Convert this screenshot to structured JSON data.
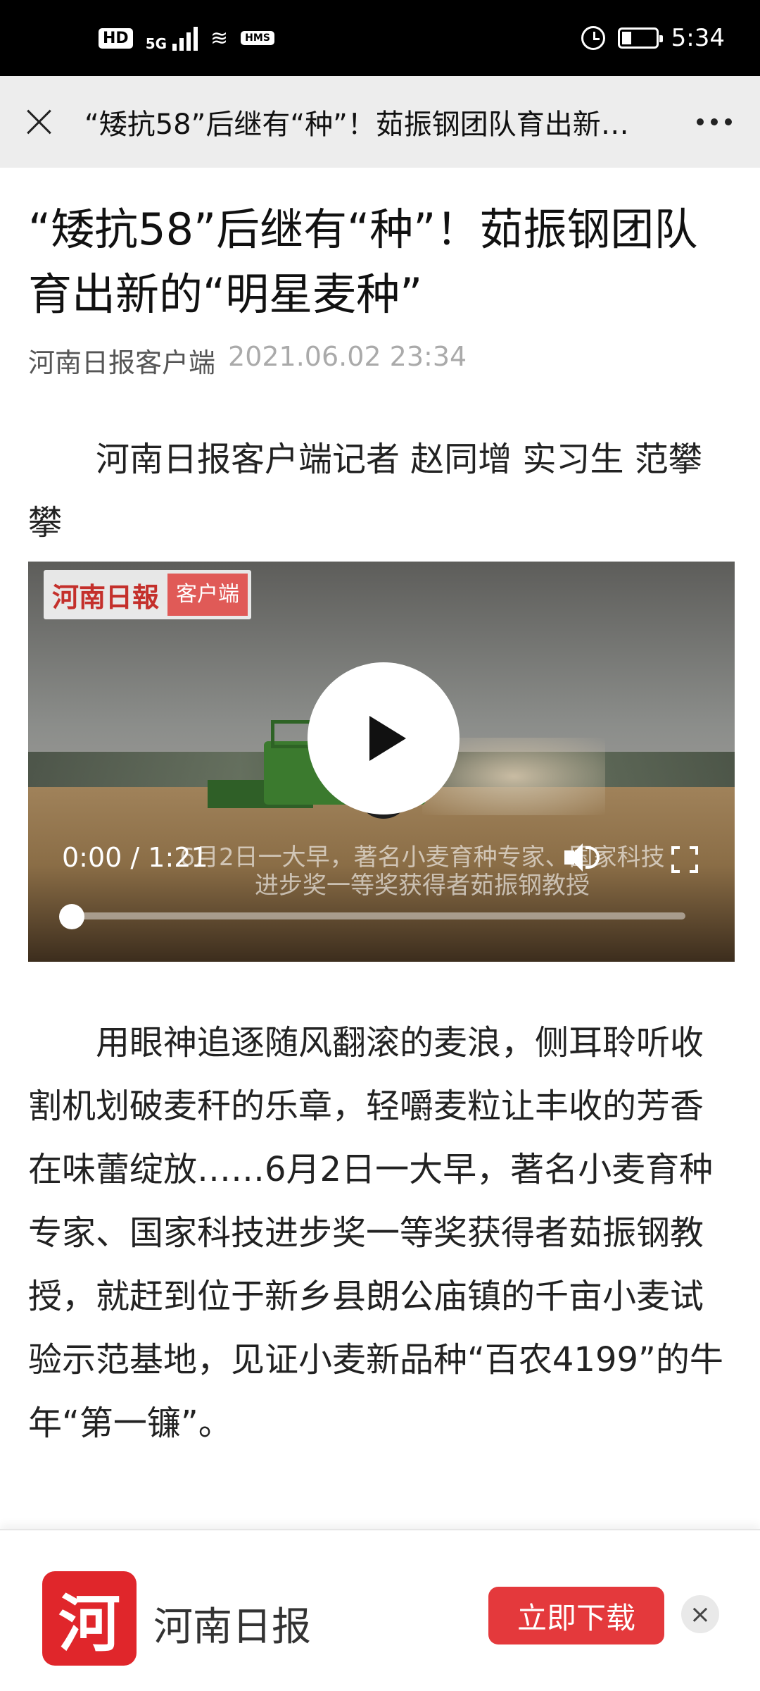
{
  "status_bar": {
    "left_chips": [
      "HD",
      "5G",
      "HMS"
    ],
    "time": "5:34"
  },
  "topbar": {
    "title": "“矮抗58”后继有“种”！茹振钢团队育出新…"
  },
  "article": {
    "headline": "“矮抗58”后继有“种”！茹振钢团队育出新的“明星麦种”",
    "source": "河南日报客户端",
    "datetime": "2021.06.02 23:34",
    "byline": "河南日报客户端记者 赵同增 实习生 范攀攀",
    "video": {
      "logo_name": "河南日報",
      "logo_tag": "客户端",
      "subtitle": "6月2日一大早，著名小麦育种专家、国家科技进步奖一等奖获得者茹振钢教授",
      "time": "0:00 / 1:21",
      "progress": 0
    },
    "paragraph": "用眼神追逐随风翻滚的麦浪，侧耳聆听收割机划破麦秆的乐章，轻嚼麦粒让丰收的芳香在味蕾绽放……6月2日一大早，著名小麦育种专家、国家科技进步奖一等奖获得者茹振钢教授，就赶到位于新乡县朗公庙镇的千亩小麦试验示范基地，见证小麦新品种“百农4199”的牛年“第一镰”。"
  },
  "banner": {
    "logo_char": "河",
    "app_name": "河南日报",
    "download_label": "立即下载",
    "close_glyph": "×"
  },
  "colors": {
    "accent_red": "#e4393c",
    "logo_red": "#e0262b",
    "topbar_bg": "#ededed"
  }
}
